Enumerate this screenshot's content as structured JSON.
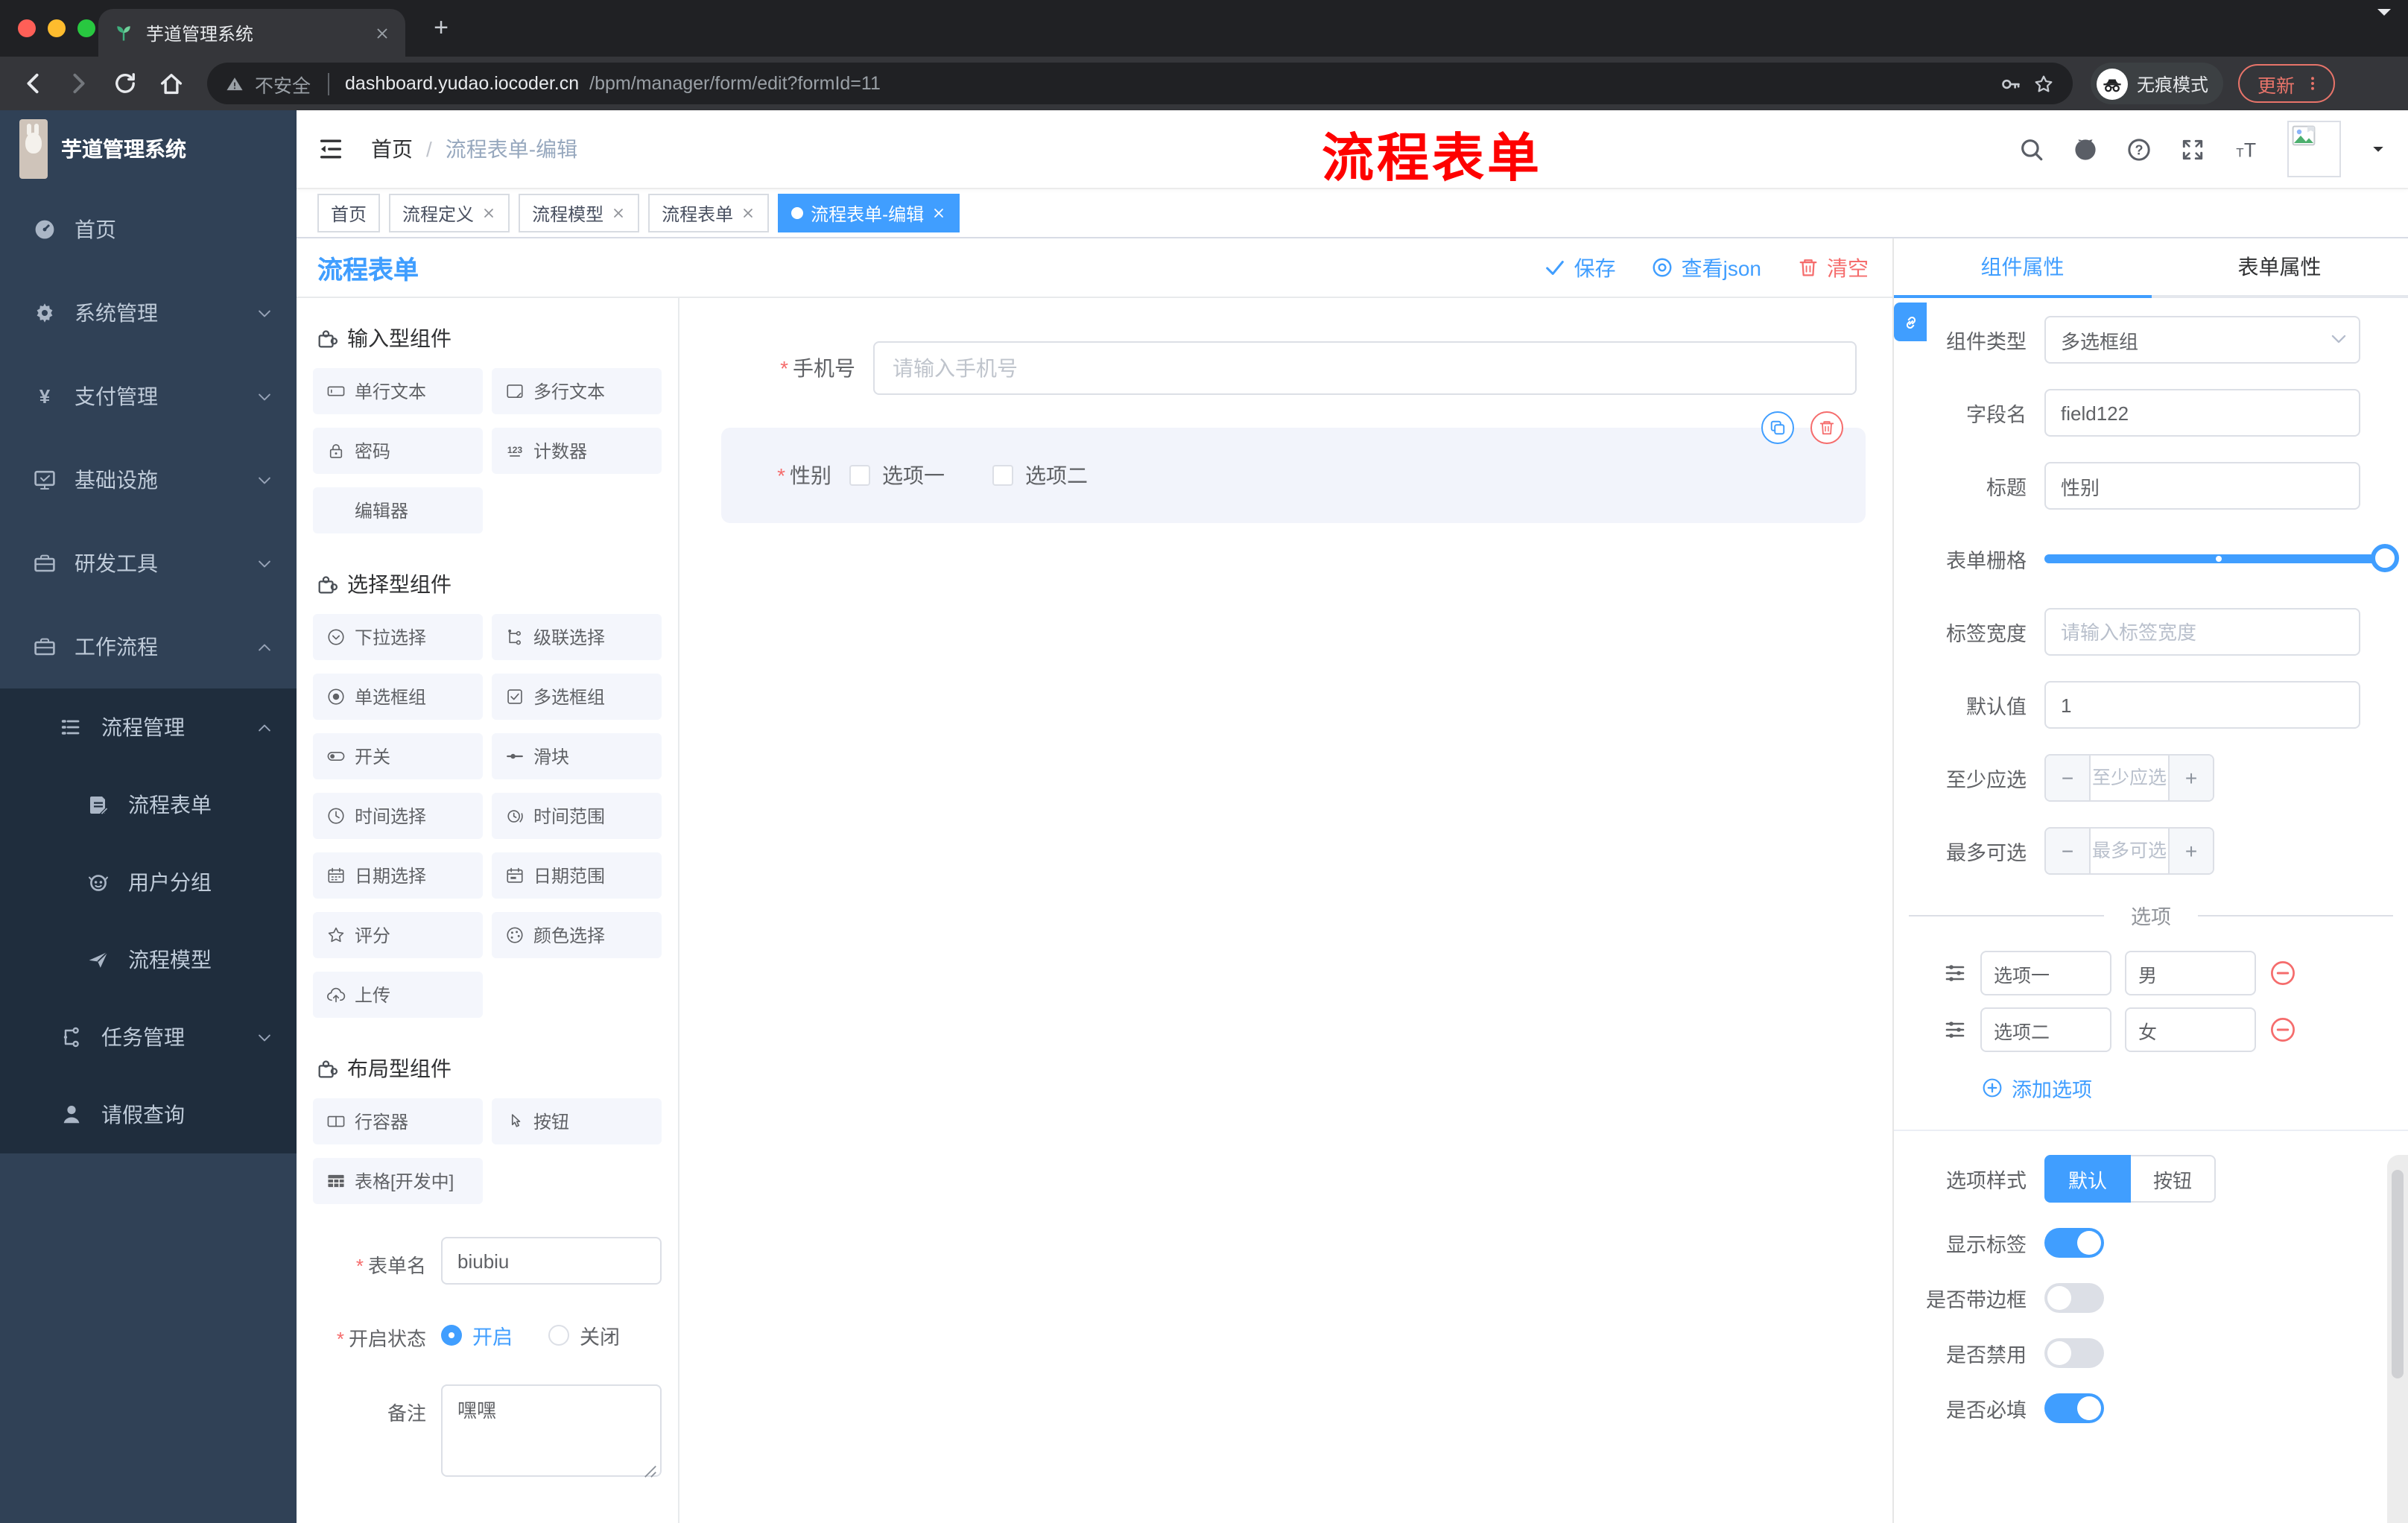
{
  "browser": {
    "tab_title": "芋道管理系统",
    "security_label": "不安全",
    "url_host": "dashboard.yudao.iocoder.cn",
    "url_path": "/bpm/manager/form/edit?formId=11",
    "incognito_label": "无痕模式",
    "update_label": "更新"
  },
  "app_header": {
    "breadcrumb": {
      "home": "首页",
      "separator": "/",
      "current": "流程表单-编辑"
    },
    "overlay_title": "流程表单"
  },
  "sidebar": {
    "logo_text": "芋道管理系统",
    "items": [
      {
        "label": "首页",
        "icon": "dashboard-icon"
      },
      {
        "label": "系统管理",
        "icon": "gear-icon",
        "state": "collapsed"
      },
      {
        "label": "支付管理",
        "icon": "yen-icon",
        "state": "collapsed"
      },
      {
        "label": "基础设施",
        "icon": "monitor-icon",
        "state": "collapsed"
      },
      {
        "label": "研发工具",
        "icon": "toolbox-icon",
        "state": "collapsed"
      },
      {
        "label": "工作流程",
        "icon": "briefcase-icon",
        "state": "expanded"
      }
    ],
    "submenu": [
      {
        "label": "流程管理",
        "icon": "flow-list-icon",
        "state": "expanded"
      },
      {
        "label": "流程表单",
        "icon": "doc-edit-icon"
      },
      {
        "label": "用户分组",
        "icon": "robot-icon"
      },
      {
        "label": "流程模型",
        "icon": "paper-plane-icon"
      },
      {
        "label": "任务管理",
        "icon": "org-tree-icon",
        "state": "collapsed"
      },
      {
        "label": "请假查询",
        "icon": "person-icon"
      }
    ]
  },
  "tags_bar": {
    "chips": [
      {
        "label": "首页",
        "active": false,
        "closable": false
      },
      {
        "label": "流程定义",
        "active": false,
        "closable": true
      },
      {
        "label": "流程模型",
        "active": false,
        "closable": true
      },
      {
        "label": "流程表单",
        "active": false,
        "closable": true
      },
      {
        "label": "流程表单-编辑",
        "active": true,
        "closable": true
      }
    ]
  },
  "designer": {
    "panel_title": "流程表单",
    "toolbar": {
      "save": "保存",
      "view_json": "查看json",
      "clear": "清空"
    },
    "palette": {
      "sections": [
        {
          "title": "输入型组件",
          "items": [
            {
              "label": "单行文本",
              "icon": "input-icon"
            },
            {
              "label": "多行文本",
              "icon": "textarea-icon"
            },
            {
              "label": "密码",
              "icon": "lock-icon"
            },
            {
              "label": "计数器",
              "icon": "counter-icon"
            },
            {
              "label": "编辑器",
              "icon": ""
            }
          ]
        },
        {
          "title": "选择型组件",
          "items": [
            {
              "label": "下拉选择",
              "icon": "select-icon"
            },
            {
              "label": "级联选择",
              "icon": "cascader-icon"
            },
            {
              "label": "单选框组",
              "icon": "radio-icon"
            },
            {
              "label": "多选框组",
              "icon": "checkbox-icon"
            },
            {
              "label": "开关",
              "icon": "switch-icon"
            },
            {
              "label": "滑块",
              "icon": "slider-icon"
            },
            {
              "label": "时间选择",
              "icon": "time-icon"
            },
            {
              "label": "时间范围",
              "icon": "time-range-icon"
            },
            {
              "label": "日期选择",
              "icon": "date-icon"
            },
            {
              "label": "日期范围",
              "icon": "date-range-icon"
            },
            {
              "label": "评分",
              "icon": "star-icon"
            },
            {
              "label": "颜色选择",
              "icon": "color-icon"
            },
            {
              "label": "上传",
              "icon": "upload-icon"
            }
          ]
        },
        {
          "title": "布局型组件",
          "items": [
            {
              "label": "行容器",
              "icon": "row-icon"
            },
            {
              "label": "按钮",
              "icon": "pointer-icon"
            },
            {
              "label": "表格[开发中]",
              "icon": "table-icon"
            }
          ]
        }
      ]
    },
    "form_meta": {
      "name": {
        "label": "表单名",
        "value": "biubiu",
        "required": true
      },
      "status": {
        "label": "开启状态",
        "required": true,
        "options": [
          "开启",
          "关闭"
        ],
        "selected": "开启"
      },
      "remark": {
        "label": "备注",
        "value": "嘿嘿"
      }
    },
    "canvas": {
      "phone_field": {
        "label": "手机号",
        "required": true,
        "placeholder": "请输入手机号"
      },
      "gender_field": {
        "label": "性别",
        "required": true,
        "options": [
          "选项一",
          "选项二"
        ]
      }
    }
  },
  "inspector": {
    "tabs": [
      {
        "label": "组件属性",
        "active": true
      },
      {
        "label": "表单属性",
        "active": false
      }
    ],
    "fields": {
      "component_type": {
        "label": "组件类型",
        "value": "多选框组"
      },
      "field_name": {
        "label": "字段名",
        "value": "field122"
      },
      "title": {
        "label": "标题",
        "value": "性别"
      },
      "form_grid": {
        "label": "表单栅格"
      },
      "label_width": {
        "label": "标签宽度",
        "placeholder": "请输入标签宽度"
      },
      "default_value": {
        "label": "默认值",
        "value": "1"
      },
      "min_select": {
        "label": "至少应选",
        "placeholder": "至少应选"
      },
      "max_select": {
        "label": "最多可选",
        "placeholder": "最多可选"
      }
    },
    "options_section": {
      "title": "选项",
      "rows": [
        {
          "name": "选项一",
          "value": "男"
        },
        {
          "name": "选项二",
          "value": "女"
        }
      ],
      "add_label": "添加选项"
    },
    "option_style": {
      "label": "选项样式",
      "choices": [
        "默认",
        "按钮"
      ],
      "selected": "默认"
    },
    "switches": [
      {
        "label": "显示标签",
        "on": true
      },
      {
        "label": "是否带边框",
        "on": false
      },
      {
        "label": "是否禁用",
        "on": false
      },
      {
        "label": "是否必填",
        "on": true
      }
    ]
  },
  "colors": {
    "accent": "#409eff",
    "danger": "#f56c6c",
    "sidebar_bg": "#304156",
    "submenu_bg": "#1f2d3d",
    "annotation_red": "#fe0100"
  }
}
